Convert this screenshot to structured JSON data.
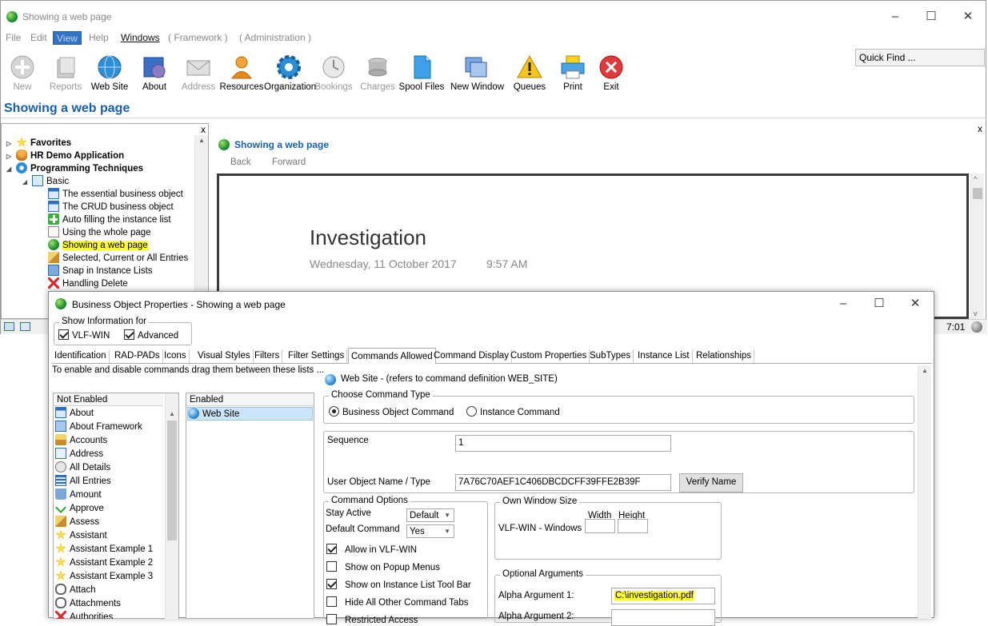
{
  "main_window": {
    "title": "Showing a web page",
    "menu": [
      "File",
      "Edit",
      "View",
      "Help",
      "Windows",
      "( Framework )",
      "( Administration )"
    ],
    "quick_find": "Quick Find ...",
    "toolbar": [
      {
        "label": "New",
        "icon": "plus-icon",
        "enabled": false
      },
      {
        "label": "Reports",
        "icon": "reports-icon",
        "enabled": false
      },
      {
        "label": "Web Site",
        "icon": "globe-icon",
        "enabled": true
      },
      {
        "label": "About",
        "icon": "about-icon",
        "enabled": true
      },
      {
        "label": "Address",
        "icon": "envelope-icon",
        "enabled": false
      },
      {
        "label": "Resources",
        "icon": "person-icon",
        "enabled": true
      },
      {
        "label": "Organization",
        "icon": "gear-icon",
        "enabled": true
      },
      {
        "label": "Bookings",
        "icon": "clock-icon",
        "enabled": false
      },
      {
        "label": "Charges",
        "icon": "coins-icon",
        "enabled": false
      },
      {
        "label": "Spool Files",
        "icon": "document-icon",
        "enabled": true
      },
      {
        "label": "New Window",
        "icon": "new-window-icon",
        "enabled": true
      },
      {
        "label": "Queues",
        "icon": "warning-icon",
        "enabled": true
      },
      {
        "label": "Print",
        "icon": "printer-icon",
        "enabled": true
      },
      {
        "label": "Exit",
        "icon": "exit-icon",
        "enabled": true
      }
    ],
    "page_title": "Showing a web page",
    "tree": {
      "close": "x",
      "items": [
        {
          "label": "Favorites",
          "level": 0,
          "bold": true,
          "expander": "▷",
          "icon": "star-icon"
        },
        {
          "label": "HR Demo Application",
          "level": 0,
          "bold": true,
          "expander": "▷",
          "icon": "person-icon"
        },
        {
          "label": "Programming Techniques",
          "level": 0,
          "bold": true,
          "expander": "◢",
          "icon": "gear-icon"
        },
        {
          "label": "Basic",
          "level": 1,
          "bold": false,
          "expander": "◢",
          "icon": "window-icon"
        },
        {
          "label": "The essential business object",
          "level": 2,
          "bold": false,
          "expander": "",
          "icon": "form-icon"
        },
        {
          "label": "The CRUD business object",
          "level": 2,
          "bold": false,
          "expander": "",
          "icon": "form-icon"
        },
        {
          "label": "Auto filling the instance list",
          "level": 2,
          "bold": false,
          "expander": "",
          "icon": "plus-green-icon"
        },
        {
          "label": "Using the whole page",
          "level": 2,
          "bold": false,
          "expander": "",
          "icon": "page-icon"
        },
        {
          "label": "Showing a web page",
          "level": 2,
          "bold": false,
          "expander": "",
          "icon": "globe-icon",
          "highlight": true
        },
        {
          "label": "Selected, Current or All Entries",
          "level": 2,
          "bold": false,
          "expander": "",
          "icon": "pencil-icon"
        },
        {
          "label": "Snap in Instance Lists",
          "level": 2,
          "bold": false,
          "expander": "",
          "icon": "snap-icon"
        },
        {
          "label": "Handling Delete",
          "level": 2,
          "bold": false,
          "expander": "",
          "icon": "delete-icon"
        }
      ]
    },
    "web_panel": {
      "title": "Showing a web page",
      "back": "Back",
      "forward": "Forward",
      "close": "x",
      "heading": "Investigation",
      "date": "Wednesday, 11 October 2017",
      "time": "9:57 AM"
    },
    "status_time": "7:01"
  },
  "dialog": {
    "title": "Business Object Properties - Showing a web page",
    "show_info": {
      "legend": "Show Information for",
      "vlf_win": {
        "label": "VLF-WIN",
        "checked": true
      },
      "advanced": {
        "label": "Advanced",
        "checked": true
      }
    },
    "tabs": [
      "Identification",
      "RAD-PADs",
      "Icons",
      "Visual Styles",
      "Filters",
      "Filter Settings",
      "Commands Allowed",
      "Command Display",
      "Custom Properties",
      "SubTypes",
      "Instance List",
      "Relationships"
    ],
    "selected_tab": "Commands Allowed",
    "hint": "To enable and disable commands drag them between these lists ...",
    "not_enabled": {
      "header": "Not Enabled",
      "items": [
        {
          "label": "About",
          "icon": "form-icon"
        },
        {
          "label": "About Framework",
          "icon": "framework-icon"
        },
        {
          "label": "Accounts",
          "icon": "accounts-icon"
        },
        {
          "label": "Address",
          "icon": "envelope-icon"
        },
        {
          "label": "All Details",
          "icon": "details-icon"
        },
        {
          "label": "All Entries",
          "icon": "entries-icon"
        },
        {
          "label": "Amount",
          "icon": "bin-icon"
        },
        {
          "label": "Approve",
          "icon": "check-icon"
        },
        {
          "label": "Assess",
          "icon": "pencil-icon"
        },
        {
          "label": "Assistant",
          "icon": "star-icon"
        },
        {
          "label": "Assistant Example 1",
          "icon": "star-icon"
        },
        {
          "label": "Assistant Example 2",
          "icon": "star-icon"
        },
        {
          "label": "Assistant Example 3",
          "icon": "star-icon"
        },
        {
          "label": "Attach",
          "icon": "paperclip-icon"
        },
        {
          "label": "Attachments",
          "icon": "paperclip-icon"
        },
        {
          "label": "Authorities",
          "icon": "delete-icon"
        }
      ]
    },
    "enabled": {
      "header": "Enabled",
      "items": [
        {
          "label": "Web Site",
          "icon": "globe-icon",
          "selected": true
        }
      ]
    },
    "command": {
      "title": "Web Site - (refers to command definition WEB_SITE)",
      "choose_type": {
        "legend": "Choose Command Type",
        "business_object": {
          "label": "Business Object Command",
          "checked": true
        },
        "instance": {
          "label": "Instance Command",
          "checked": false
        }
      },
      "sequence_label": "Sequence",
      "sequence_value": "1",
      "user_object_label": "User Object Name / Type",
      "user_object_value": "7A76C70AEF1C406DBCDCFF39FFE2B39F",
      "verify_button": "Verify Name",
      "options": {
        "legend": "Command Options",
        "stay_active_label": "Stay Active",
        "stay_active_value": "Default",
        "default_command_label": "Default Command",
        "default_command_value": "Yes",
        "checks": [
          {
            "label": "Allow in VLF-WIN",
            "checked": true
          },
          {
            "label": "Show on Popup Menus",
            "checked": false
          },
          {
            "label": "Show on Instance List Tool Bar",
            "checked": true
          },
          {
            "label": "Hide All Other Command Tabs",
            "checked": false
          },
          {
            "label": "Restricted Access",
            "checked": false
          }
        ]
      },
      "own_window": {
        "legend": "Own Window Size",
        "width_label": "Width",
        "height_label": "Height",
        "row_label": "VLF-WIN - Windows",
        "width_value": "",
        "height_value": ""
      },
      "optional_args": {
        "legend": "Optional Arguments",
        "arg1_label": "Alpha Argument 1:",
        "arg1_value": "C:\\investigation.pdf",
        "arg2_label": "Alpha Argument 2:"
      }
    }
  },
  "colors": {
    "accent": "#1a5fa8",
    "highlight": "#ffff33",
    "menu_active": "#3373c4"
  }
}
